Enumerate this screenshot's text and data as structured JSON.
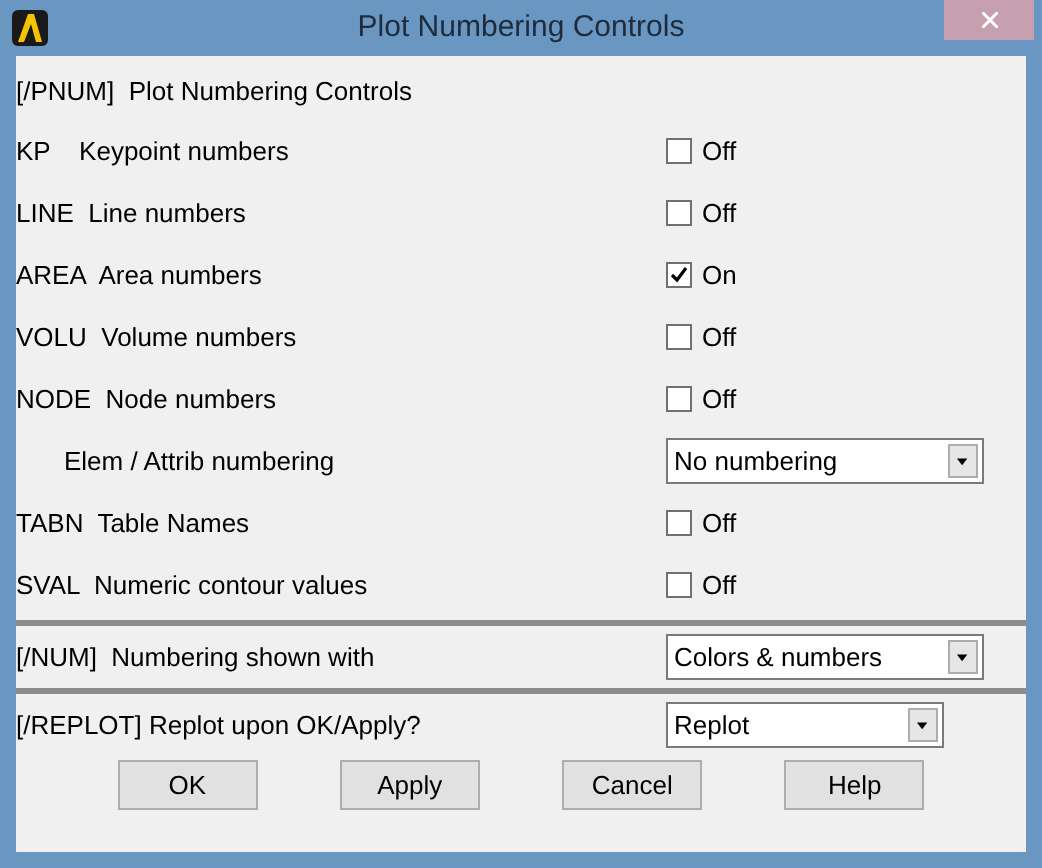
{
  "window": {
    "title": "Plot Numbering Controls"
  },
  "heading": "[/PNUM]  Plot Numbering Controls",
  "rows": [
    {
      "kind": "checkbox",
      "label": "KP    Keypoint numbers",
      "checked": false,
      "state_text": "Off"
    },
    {
      "kind": "checkbox",
      "label": "LINE  Line numbers",
      "checked": false,
      "state_text": "Off"
    },
    {
      "kind": "checkbox",
      "label": "AREA  Area numbers",
      "checked": true,
      "state_text": "On"
    },
    {
      "kind": "checkbox",
      "label": "VOLU  Volume numbers",
      "checked": false,
      "state_text": "Off"
    },
    {
      "kind": "checkbox",
      "label": "NODE  Node numbers",
      "checked": false,
      "state_text": "Off"
    },
    {
      "kind": "dropdown",
      "label": "Elem / Attrib numbering",
      "value": "No numbering"
    },
    {
      "kind": "checkbox",
      "label": "TABN  Table Names",
      "checked": false,
      "state_text": "Off"
    },
    {
      "kind": "checkbox",
      "label": "SVAL  Numeric contour values",
      "checked": false,
      "state_text": "Off"
    }
  ],
  "num": {
    "label": "[/NUM]  Numbering shown with",
    "value": "Colors & numbers"
  },
  "replot": {
    "label": "[/REPLOT] Replot upon OK/Apply?",
    "value": "Replot"
  },
  "buttons": [
    "OK",
    "Apply",
    "Cancel",
    "Help"
  ]
}
